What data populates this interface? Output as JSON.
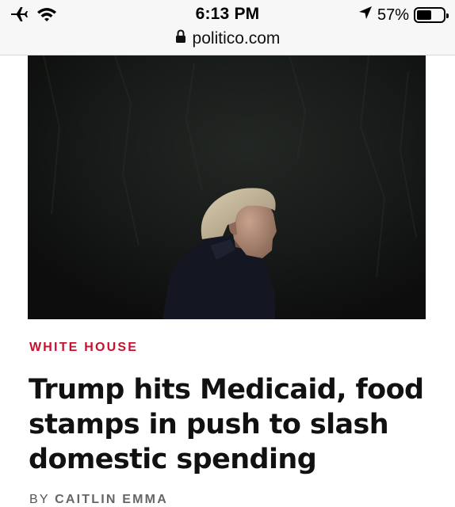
{
  "status_bar": {
    "time": "6:13 PM",
    "url": "politico.com",
    "battery_text": "57%",
    "battery_level": 0.57,
    "icons": [
      "airplane-icon",
      "wifi-icon",
      "location-arrow-icon",
      "battery-icon",
      "lock-icon"
    ]
  },
  "article": {
    "kicker": "WHITE HOUSE",
    "headline_lines": [
      "Trump hits Medicaid, food",
      "stamps in push to slash",
      "domestic spending"
    ],
    "byline_prefix": "BY",
    "author": "CAITLIN EMMA"
  },
  "colors": {
    "kicker": "#c8102e",
    "status_bar_bg": "#f7f7f7"
  }
}
